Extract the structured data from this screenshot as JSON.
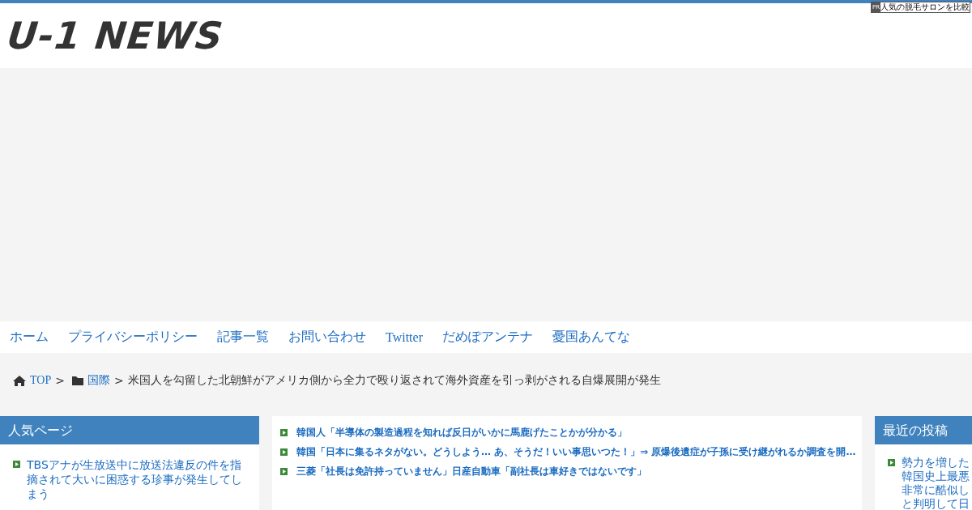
{
  "ad_label": {
    "badge": "PR",
    "text": "人気の脱毛サロンを比較"
  },
  "logo": "U-1 NEWS",
  "nav": [
    "ホーム",
    "プライバシーポリシー",
    "記事一覧",
    "お問い合わせ",
    "Twitter",
    "だめぽアンテナ",
    "憂国あんてな"
  ],
  "breadcrumb": {
    "home": "TOP",
    "sep1": ">",
    "category": "国際",
    "sep2": ">",
    "current": "米国人を勾留した北朝鮮がアメリカ側から全力で殴り返されて海外資産を引っ剥がされる自爆展開が発生"
  },
  "left_panel": {
    "title": "人気ページ",
    "items": [
      "TBSアナが生放送中に放送法違反の件を指摘されて大いに困惑する珍事が発生してしまう"
    ]
  },
  "center_links": [
    "韓国人「半導体の製造過程を知れば反日がいかに馬鹿げたことかが分かる」",
    "韓国「日本に集るネタがない。どうしよう… あ、そうだ！いい事思いつた！」⇒ 原爆後遺症が子孫に受け継がれるか調査を開…",
    "三菱「社長は免許持っていません」日産自動車「副社長は車好きではないです」"
  ],
  "right_panel": {
    "title": "最近の投稿",
    "items": [
      {
        "lines": [
          "勢力を増した",
          "韓国史上最悪",
          "非常に酷似し",
          "と判明して日"
        ]
      }
    ]
  }
}
